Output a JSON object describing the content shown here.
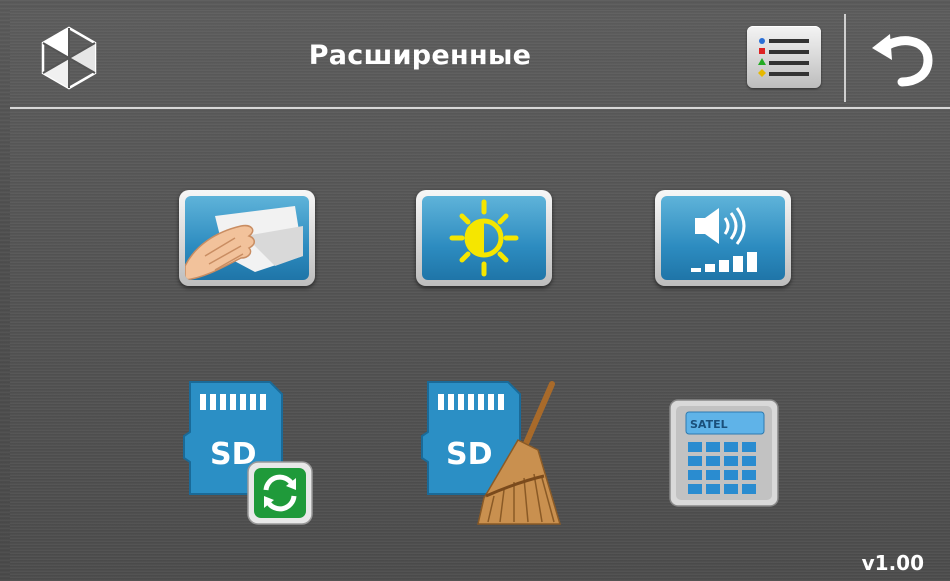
{
  "header": {
    "title": "Расширенные",
    "logo_icon": "satel-logo-icon",
    "menu_icon": "list-menu-icon",
    "back_icon": "back-arrow-icon"
  },
  "tiles": [
    {
      "name": "cleaning-icon",
      "description_icon": "hand-wiping-screen"
    },
    {
      "name": "brightness-icon",
      "description_icon": "sun-half-icon"
    },
    {
      "name": "volume-icon",
      "description_icon": "speaker-volume-icon"
    },
    {
      "name": "sd-update-icon",
      "label": "SD"
    },
    {
      "name": "sd-clear-icon",
      "label": "SD"
    },
    {
      "name": "keypad-icon",
      "label": "SATEL"
    }
  ],
  "footer": {
    "version": "v1.00"
  },
  "colors": {
    "accent": "#2d8cc0",
    "background": "#555555",
    "text": "#ffffff"
  }
}
